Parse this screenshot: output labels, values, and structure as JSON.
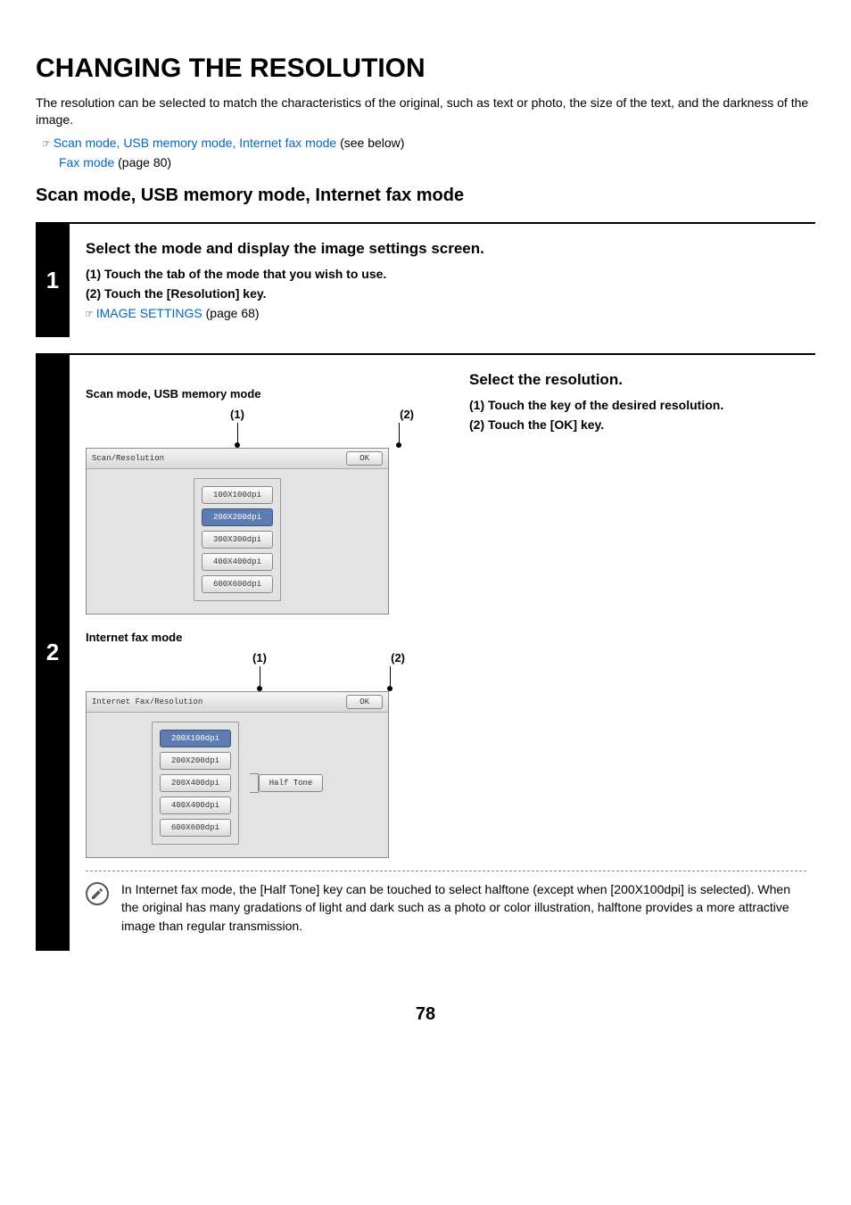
{
  "title": "CHANGING THE RESOLUTION",
  "intro": "The resolution can be selected to match the characteristics of the original, such as text or photo, the size of the text, and the darkness of the image.",
  "pointer_glyph": "☞",
  "refs": {
    "line1_link": "Scan mode, USB memory mode, Internet fax mode",
    "line1_after": " (see below)",
    "line2_link": "Fax mode",
    "line2_after": " (page 80)"
  },
  "section_heading": "Scan mode, USB memory mode, Internet fax mode",
  "step1": {
    "number": "1",
    "title": "Select the mode and display the image settings screen.",
    "sub1": "(1)  Touch the tab of the mode that you wish to use.",
    "sub2": "(2)  Touch the [Resolution] key.",
    "ref_link": "IMAGE SETTINGS",
    "ref_after": " (page 68)"
  },
  "step2": {
    "number": "2",
    "right_title": "Select the resolution.",
    "right_sub1": "(1)  Touch the key of the desired resolution.",
    "right_sub2": "(2)  Touch the [OK] key.",
    "scan_label": "Scan mode, USB memory mode",
    "callout1": "(1)",
    "callout2": "(2)",
    "scan_panel": {
      "titlebar": "Scan/Resolution",
      "ok": "OK",
      "buttons": [
        "100X100dpi",
        "200X200dpi",
        "300X300dpi",
        "400X400dpi",
        "600X600dpi"
      ],
      "selected_index": 1
    },
    "ifax_label": "Internet fax mode",
    "ifax_panel": {
      "titlebar": "Internet Fax/Resolution",
      "ok": "OK",
      "buttons": [
        "200X100dpi",
        "200X200dpi",
        "200X400dpi",
        "400X400dpi",
        "600X600dpi"
      ],
      "selected_index": 0,
      "halftone": "Half Tone"
    },
    "note": "In Internet fax mode, the [Half Tone] key can be touched to select halftone (except when [200X100dpi] is selected). When the original has many gradations of light and dark such as a photo or color illustration, halftone provides a more attractive image than regular transmission."
  },
  "page_number": "78"
}
